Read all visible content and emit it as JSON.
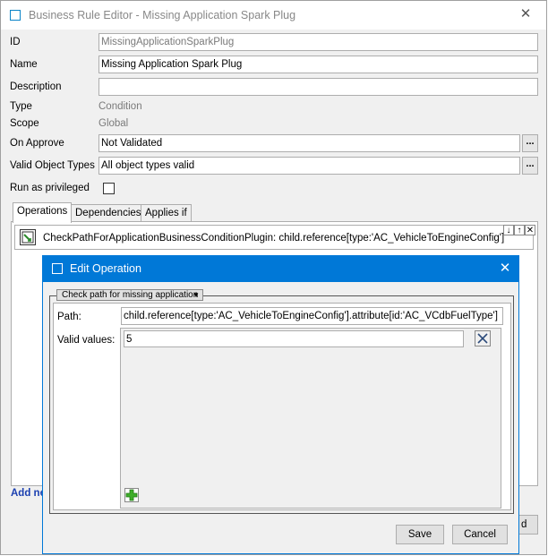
{
  "main_window": {
    "title": "Business Rule Editor - Missing Application Spark Plug",
    "close_glyph": "✕"
  },
  "form": {
    "id_label": "ID",
    "id_value": "MissingApplicationSparkPlug",
    "name_label": "Name",
    "name_value": "Missing Application Spark Plug",
    "description_label": "Description",
    "description_value": "",
    "type_label": "Type",
    "type_value": "Condition",
    "scope_label": "Scope",
    "scope_value": "Global",
    "on_approve_label": "On Approve",
    "on_approve_value": "Not Validated",
    "valid_object_types_label": "Valid Object Types",
    "valid_object_types_value": "All object types valid",
    "run_as_privileged_label": "Run as privileged",
    "browse_glyph": "..."
  },
  "tabs": [
    {
      "label": "Operations",
      "active": true
    },
    {
      "label": "Dependencies",
      "active": false
    },
    {
      "label": "Applies if",
      "active": false
    }
  ],
  "operation_row": {
    "text": "CheckPathForApplicationBusinessConditionPlugin: child.reference[type:'AC_VehicleToEngineConfig'].attribute[i...",
    "down_glyph": "↓",
    "up_glyph": "↑",
    "remove_glyph": "✕"
  },
  "add_new_label": "Add ne",
  "hidden_button_label": "d",
  "edit_dialog": {
    "title": "Edit Operation",
    "close_glyph": "✕",
    "group_selector": "Check path for missing application",
    "dropdown_glyph": "▼",
    "path_label": "Path:",
    "path_value": "child.reference[type:'AC_VehicleToEngineConfig'].attribute[id:'AC_VCdbFuelType']",
    "valid_values_label": "Valid values:",
    "valid_value_1": "5",
    "save_label": "Save",
    "cancel_label": "Cancel"
  },
  "colors": {
    "dialog_title_bar": "#0078d7",
    "link_blue": "#1a3fb0",
    "add_green": "#3fae2a"
  }
}
